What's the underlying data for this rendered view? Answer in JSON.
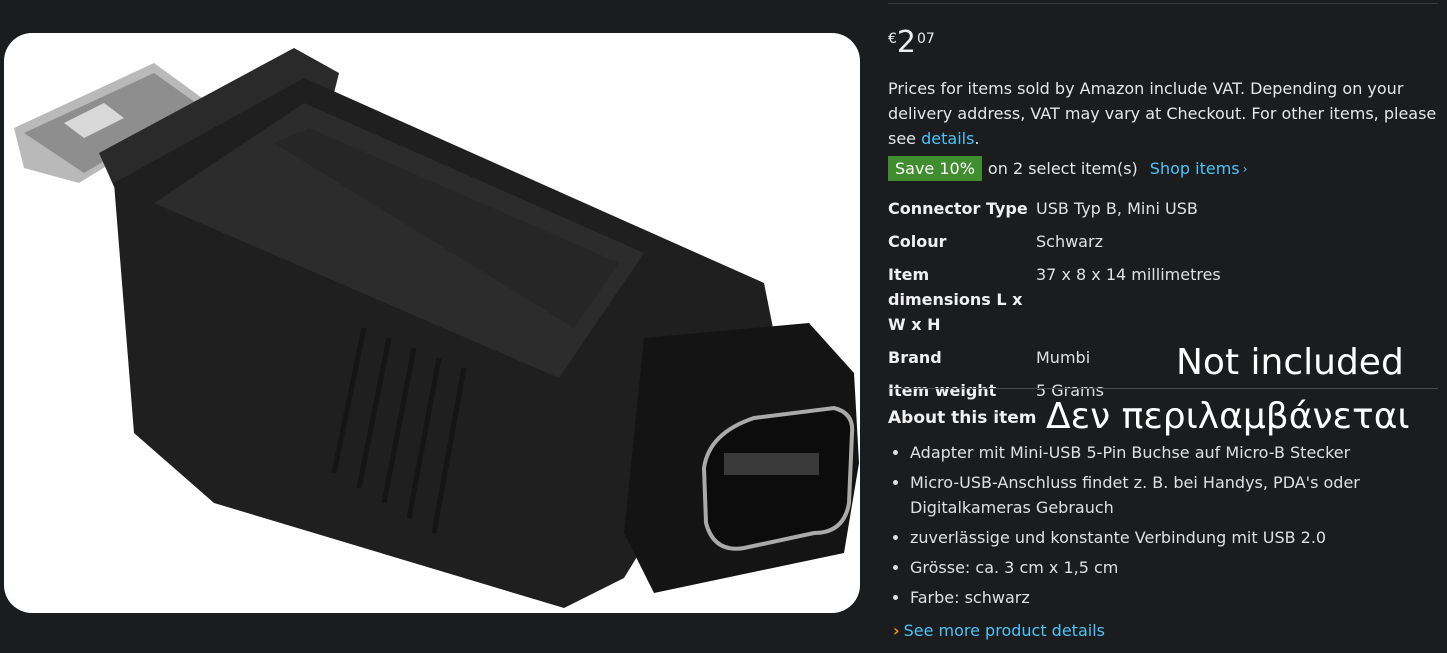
{
  "image": {
    "alt_name": "usb-adapter-product-photo"
  },
  "price": {
    "currency": "€",
    "whole": "2",
    "fraction": "07"
  },
  "vat_notice": {
    "text": "Prices for items sold by Amazon include VAT. Depending on your delivery address, VAT may vary at Checkout. For other items, please see ",
    "link": "details",
    "end": "."
  },
  "promo": {
    "badge": "Save 10%",
    "text": "on 2 select item(s)",
    "link": "Shop items",
    "chevron": "›"
  },
  "specs": [
    {
      "key": "Connector Type",
      "value": "USB Typ B, Mini USB"
    },
    {
      "key": "Colour",
      "value": "Schwarz"
    },
    {
      "key": "Item dimensions L x W x H",
      "value": "37 x 8 x 14 millimetres"
    },
    {
      "key": "Brand",
      "value": "Mumbi"
    },
    {
      "key": "Item weight",
      "value": "5 Grams"
    }
  ],
  "overlay": {
    "english": "Not included",
    "greek": "Δεν περιλαμβάνεται"
  },
  "about": {
    "heading": "About this item"
  },
  "bullets": [
    "Adapter mit Mini-USB 5-Pin Buchse auf Micro-B Stecker",
    "Micro-USB-Anschluss findet z. B. bei Handys, PDA's oder Digitalkameras Gebrauch",
    "zuverlässige und konstante Verbindung mit USB 2.0",
    "Grösse: ca. 3 cm x 1,5 cm",
    "Farbe: schwarz"
  ],
  "see_more": {
    "arrow": "›",
    "label": "See more product details"
  },
  "colors": {
    "background": "#1b1c1e",
    "link": "#4fc3f7",
    "badge": "#3f8d2f",
    "arrow": "#f08a24"
  }
}
